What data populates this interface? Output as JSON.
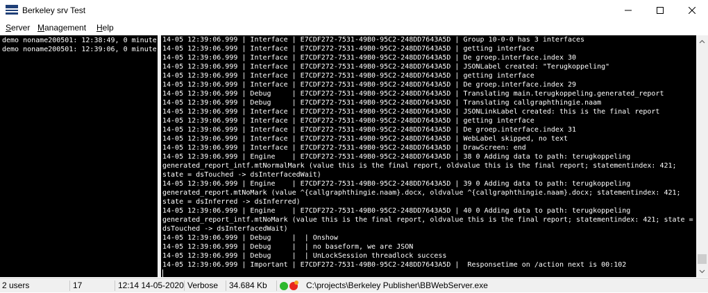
{
  "window": {
    "title": "Berkeley srv Test",
    "icons": [
      "app-icon",
      "minimize-icon",
      "maximize-icon",
      "close-icon"
    ]
  },
  "menu": {
    "server": "Server",
    "management": "Management",
    "help": "Help"
  },
  "sessions": [
    "demo noname200501: 12:38:49, 0 minute",
    "demo noname200501: 12:39:06, 0 minute"
  ],
  "log_lines": [
    "14-05 12:39:06.999 | Interface | E7CDF272-7531-49B0-95C2-248DD7643A5D | Group 10-0-0 has 3 interfaces",
    "14-05 12:39:06.999 | Interface | E7CDF272-7531-49B0-95C2-248DD7643A5D | getting interface",
    "14-05 12:39:06.999 | Interface | E7CDF272-7531-49B0-95C2-248DD7643A5D | De groep.interface.index 30",
    "14-05 12:39:06.999 | Interface | E7CDF272-7531-49B0-95C2-248DD7643A5D | JSONLabel created: \"Terugkoppeling\"",
    "14-05 12:39:06.999 | Interface | E7CDF272-7531-49B0-95C2-248DD7643A5D | getting interface",
    "14-05 12:39:06.999 | Interface | E7CDF272-7531-49B0-95C2-248DD7643A5D | De groep.interface.index 29",
    "14-05 12:39:06.999 | Debug     | E7CDF272-7531-49B0-95C2-248DD7643A5D | Translating main.terugkoppeling.generated_report",
    "14-05 12:39:06.999 | Debug     | E7CDF272-7531-49B0-95C2-248DD7643A5D | Translating callgraphthingie.naam",
    "14-05 12:39:06.999 | Interface | E7CDF272-7531-49B0-95C2-248DD7643A5D | JSONLinkLabel created: this is the final report",
    "14-05 12:39:06.999 | Interface | E7CDF272-7531-49B0-95C2-248DD7643A5D | getting interface",
    "14-05 12:39:06.999 | Interface | E7CDF272-7531-49B0-95C2-248DD7643A5D | De groep.interface.index 31",
    "14-05 12:39:06.999 | Interface | E7CDF272-7531-49B0-95C2-248DD7643A5D | WebLabel skipped, no text",
    "14-05 12:39:06.999 | Interface | E7CDF272-7531-49B0-95C2-248DD7643A5D | DrawScreen: end",
    "14-05 12:39:06.999 | Engine    | E7CDF272-7531-49B0-95C2-248DD7643A5D | 38 0 Adding data to path: terugkoppeling",
    "generated_report_intf.mtNormalMark (value this is the final report, oldvalue this is the final report; statementindex: 421;",
    "state = dsTouched -> dsInterfacedWait)",
    "14-05 12:39:06.999 | Engine    | E7CDF272-7531-49B0-95C2-248DD7643A5D | 39 0 Adding data to path: terugkoppeling",
    "generated_report.mtNoMark (value ^{callgraphthingie.naam}.docx, oldvalue ^{callgraphthingie.naam}.docx; statementindex: 421;",
    "state = dsInferred -> dsInferred)",
    "14-05 12:39:06.999 | Engine    | E7CDF272-7531-49B0-95C2-248DD7643A5D | 40 0 Adding data to path: terugkoppeling",
    "generated_report_intf.mtNoMark (value this is the final report, oldvalue this is the final report; statementindex: 421; state =",
    "dsTouched -> dsInterfacedWait)",
    "14-05 12:39:06.999 | Debug     |  | Onshow",
    "14-05 12:39:06.999 | Debug     |  | no baseform, we are JSON",
    "14-05 12:39:06.999 | Debug     |  | UnLockSession threadlock success",
    "14-05 12:39:06.999 | Important | E7CDF272-7531-49B0-95C2-248DD7643A5D |  Responsetime on /action next is 00:102"
  ],
  "status": {
    "users": "2 users",
    "count": "17",
    "datetime": "12:14 14-05-2020",
    "level": "Verbose",
    "memory": "34.684 Kb",
    "path": "C:\\projects\\Berkeley Publisher\\BBWebServer.exe",
    "icons": [
      "status-ok-icon",
      "status-alert-icon"
    ],
    "colors": {
      "ok": "#2eb82e",
      "alert": "#e8261d"
    }
  }
}
